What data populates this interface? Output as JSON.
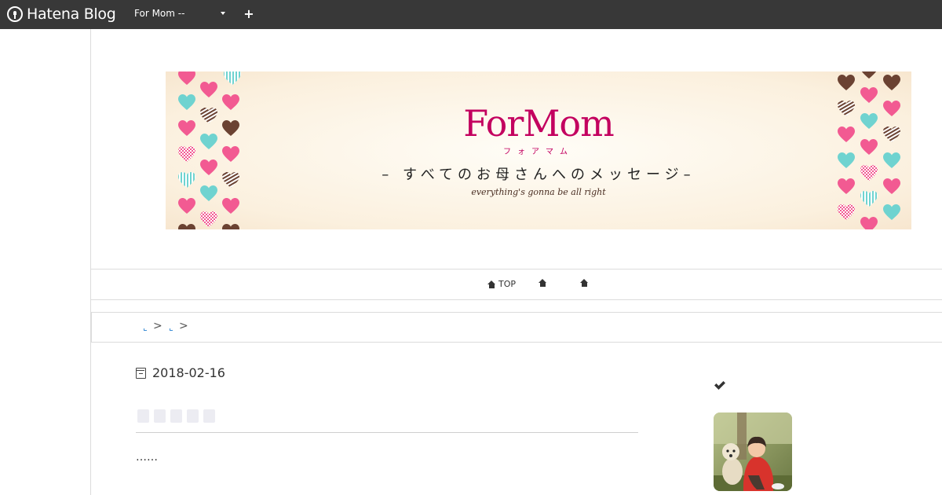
{
  "topbar": {
    "logo_text": "Hatena Blog",
    "blog_select_value": "For Mom --",
    "add_label": "+"
  },
  "banner": {
    "title": "ForMom",
    "kana": "フォアマム",
    "subtitle": "– すべてのお母さんへのメッセージ–",
    "tagline": "everything's gonna be all right"
  },
  "nav": {
    "items": [
      {
        "label": "TOP",
        "icon": "home-icon"
      },
      {
        "label": "",
        "icon": "home-icon"
      },
      {
        "label": "",
        "icon": "home-icon"
      }
    ]
  },
  "breadcrumb": {
    "separator": ">"
  },
  "article": {
    "date": "2018-02-16",
    "excerpt": "……"
  },
  "sidebar": {
    "check_icon": "check-icon",
    "profile_image": "profile-photo"
  },
  "colors": {
    "topbar": "#383838",
    "brand_magenta": "#c3005f",
    "heart_pink": "#f25a92",
    "heart_teal": "#6fd3d0",
    "heart_brown": "#6b4232"
  }
}
